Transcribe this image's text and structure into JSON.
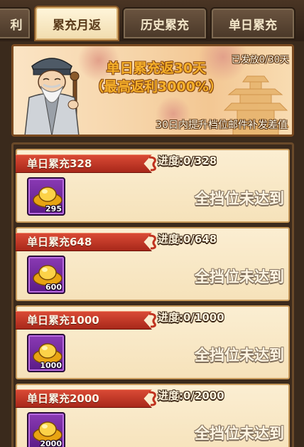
{
  "tabs": [
    {
      "label": "利",
      "active": false
    },
    {
      "label": "累充月返",
      "active": true
    },
    {
      "label": "历史累充",
      "active": false
    },
    {
      "label": "单日累充",
      "active": false
    }
  ],
  "banner": {
    "title": "单日累充返30天",
    "subtitle": "（最高返利3000%）",
    "issued": "已发放0/30天",
    "note": "30日内提升档位邮件补发差值"
  },
  "tiers": [
    {
      "label": "单日累充328",
      "progress": "进度:0/328",
      "reward_qty": "295",
      "status": "全挡位未达到"
    },
    {
      "label": "单日累充648",
      "progress": "进度:0/648",
      "reward_qty": "600",
      "status": "全挡位未达到"
    },
    {
      "label": "单日累充1000",
      "progress": "进度:0/1000",
      "reward_qty": "1000",
      "status": "全挡位未达到"
    },
    {
      "label": "单日累充2000",
      "progress": "进度:0/2000",
      "reward_qty": "2000",
      "status": "全挡位未达到"
    }
  ],
  "colors": {
    "accent_gold": "#f6b02a",
    "ribbon_red": "#c0321f",
    "slot_purple": "#7a2aa8"
  }
}
